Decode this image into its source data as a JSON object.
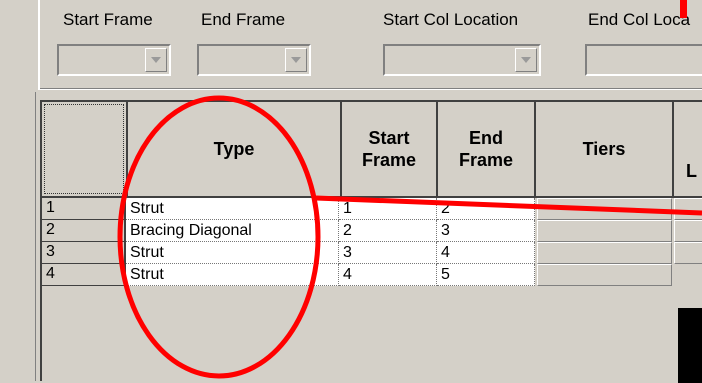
{
  "filters": {
    "start_frame_label": "Start Frame",
    "end_frame_label": "End Frame",
    "start_col_location_label": "Start Col Location",
    "end_col_location_label": "End Col Loca"
  },
  "table": {
    "headers": {
      "type": "Type",
      "start_frame_1": "Start",
      "start_frame_2": "Frame",
      "end_frame_1": "End",
      "end_frame_2": "Frame",
      "tiers": "Tiers",
      "partial": "L"
    },
    "rows": [
      {
        "num": "1",
        "type": "Strut",
        "start": "1",
        "end": "2"
      },
      {
        "num": "2",
        "type": "Bracing Diagonal",
        "start": "2",
        "end": "3"
      },
      {
        "num": "3",
        "type": "Strut",
        "start": "3",
        "end": "4"
      },
      {
        "num": "4",
        "type": "Strut",
        "start": "4",
        "end": "5"
      }
    ]
  },
  "annotations": {
    "accent_color": "#ff0000"
  }
}
